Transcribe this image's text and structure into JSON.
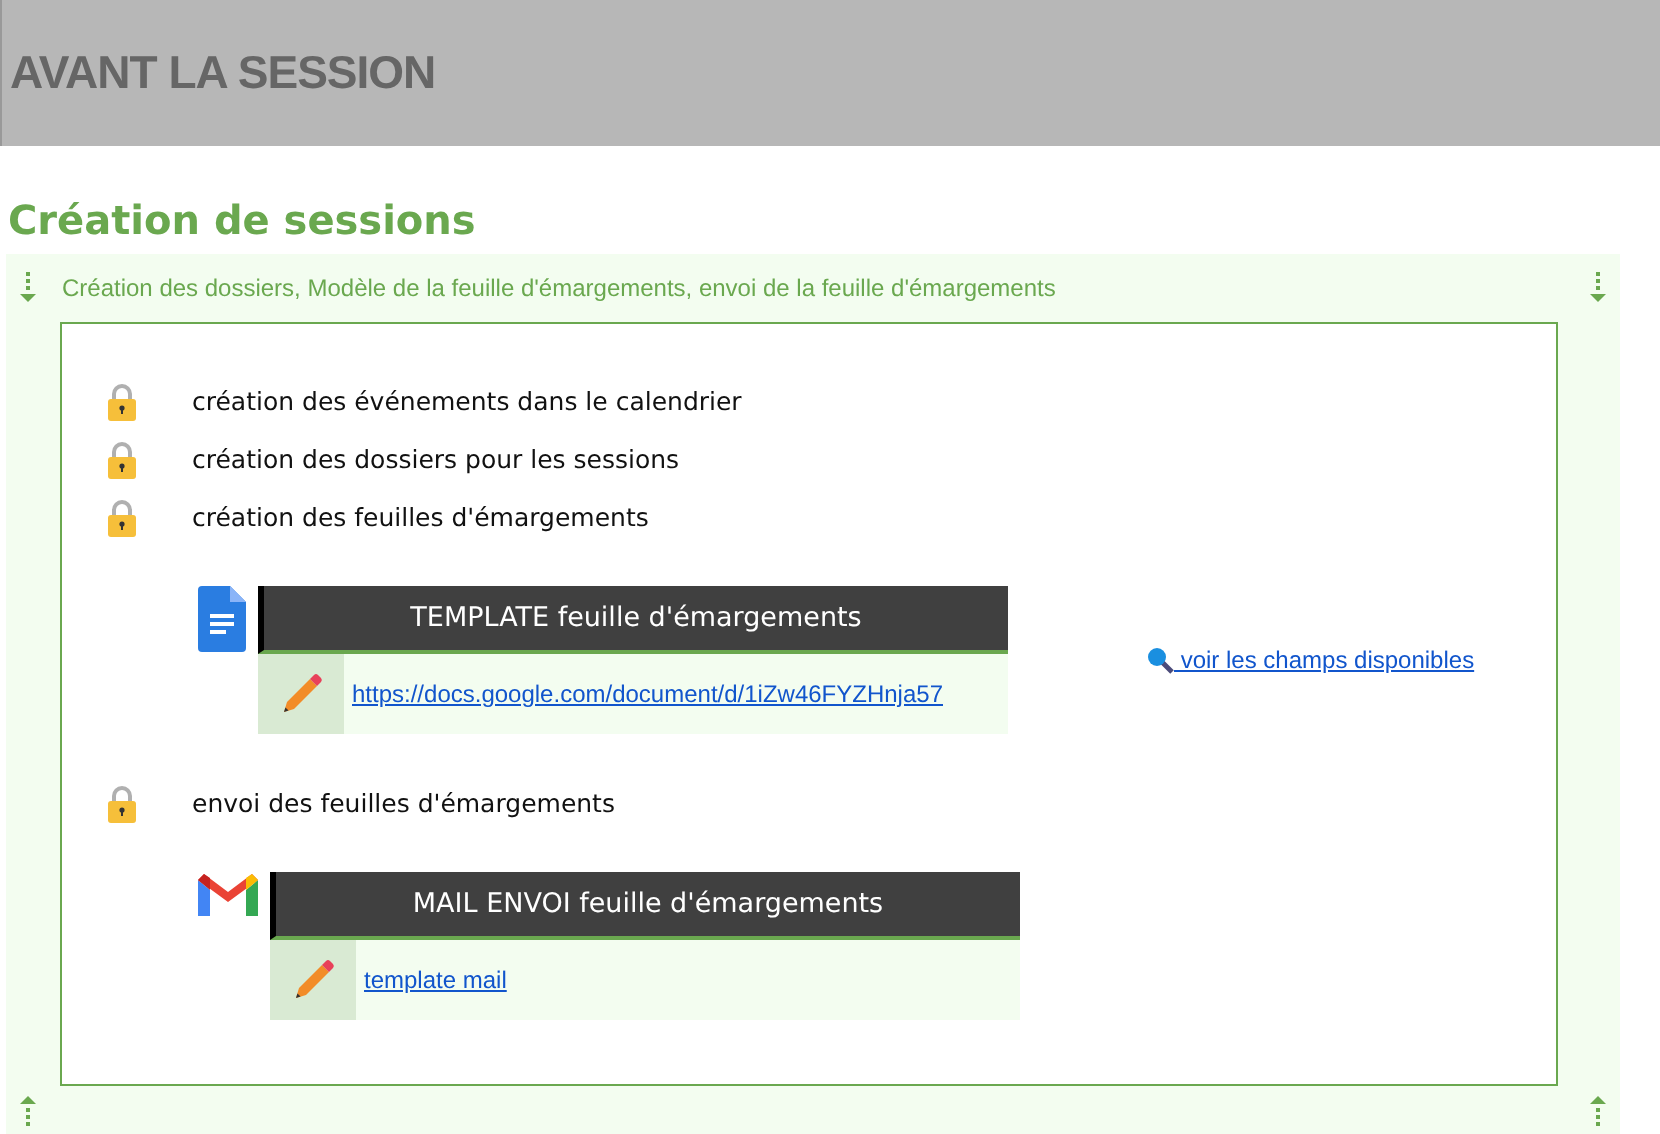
{
  "header": {
    "title": "AVANT LA SESSION"
  },
  "section": {
    "title": "Création de sessions",
    "summary": "Création des dossiers, Modèle de la feuille d'émargements, envoi de la feuille d'émargements",
    "items": [
      {
        "kind": "task",
        "text": "création des événements dans le calendrier"
      },
      {
        "kind": "task",
        "text": "création des dossiers pour les sessions"
      },
      {
        "kind": "task",
        "text": "création des feuilles d'émargements"
      },
      {
        "kind": "doc",
        "title": "TEMPLATE feuille d'émargements",
        "link": "https://docs.google.com/document/d/1iZw46FYZHnja57",
        "side_link": "voir les champs disponibles"
      },
      {
        "kind": "task",
        "text": "envoi des feuilles d'émargements"
      },
      {
        "kind": "mail",
        "title": "MAIL ENVOI feuille d'émargements",
        "link": "template mail"
      }
    ]
  }
}
